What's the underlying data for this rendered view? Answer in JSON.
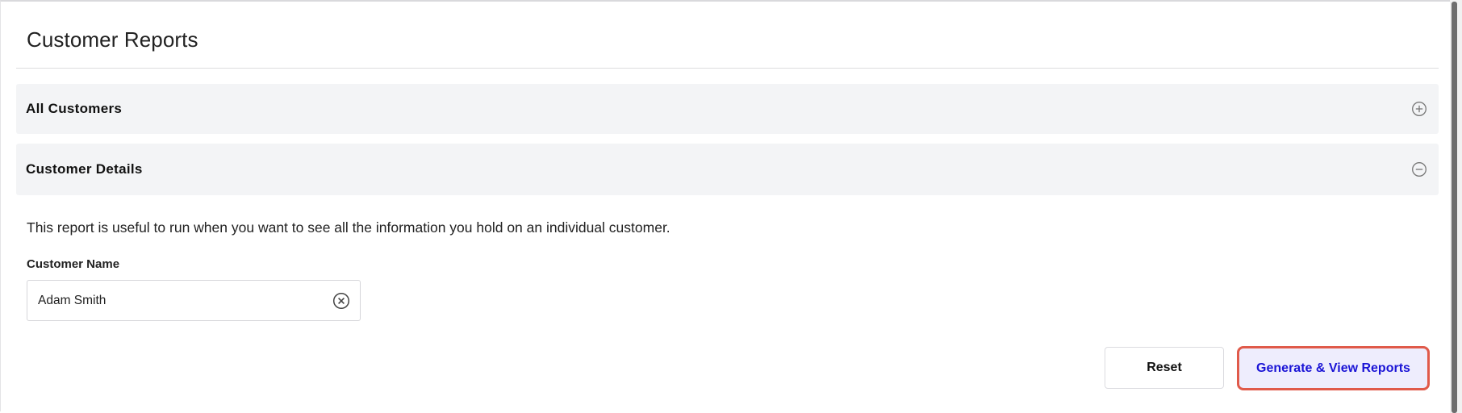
{
  "page": {
    "title": "Customer Reports"
  },
  "accordions": [
    {
      "label": "All Customers",
      "state": "collapsed",
      "icon": "plus-circle-icon"
    },
    {
      "label": "Customer Details",
      "state": "expanded",
      "icon": "minus-circle-icon"
    }
  ],
  "customer_details": {
    "description": "This report is useful to run when you want to see all the information you hold on an individual customer.",
    "field_label": "Customer Name",
    "field_value": "Adam Smith",
    "clear_icon": "clear-circle-icon"
  },
  "actions": {
    "reset_label": "Reset",
    "generate_label": "Generate & View Reports"
  },
  "colors": {
    "accordion_bg": "#f3f4f6",
    "primary_text": "#1a14d6",
    "primary_bg": "#eeedfd",
    "focus_ring": "#e05a4a"
  }
}
